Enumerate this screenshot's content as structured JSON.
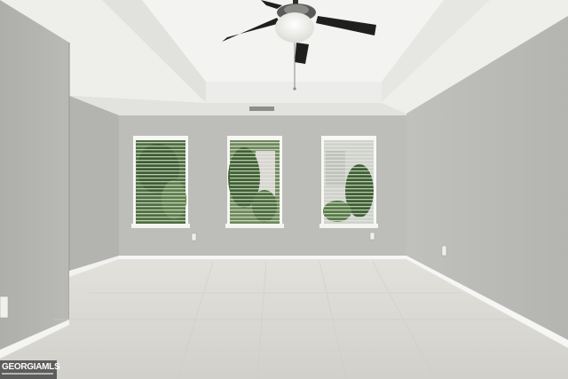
{
  "photo": {
    "watermark": {
      "text": "GEORGIAMLS"
    },
    "colors": {
      "ceiling": "#f1f1ef",
      "tray": "#e9e9e6",
      "back_wall": "#bdbdb9",
      "left_wall": "#b2b2ae",
      "right_wall": "#b9b9b5",
      "carpet": "#d9d7d2",
      "trim": "#f7f7f5",
      "fan_blade": "#1f1f1f",
      "foliage": "#3f6a34"
    }
  }
}
